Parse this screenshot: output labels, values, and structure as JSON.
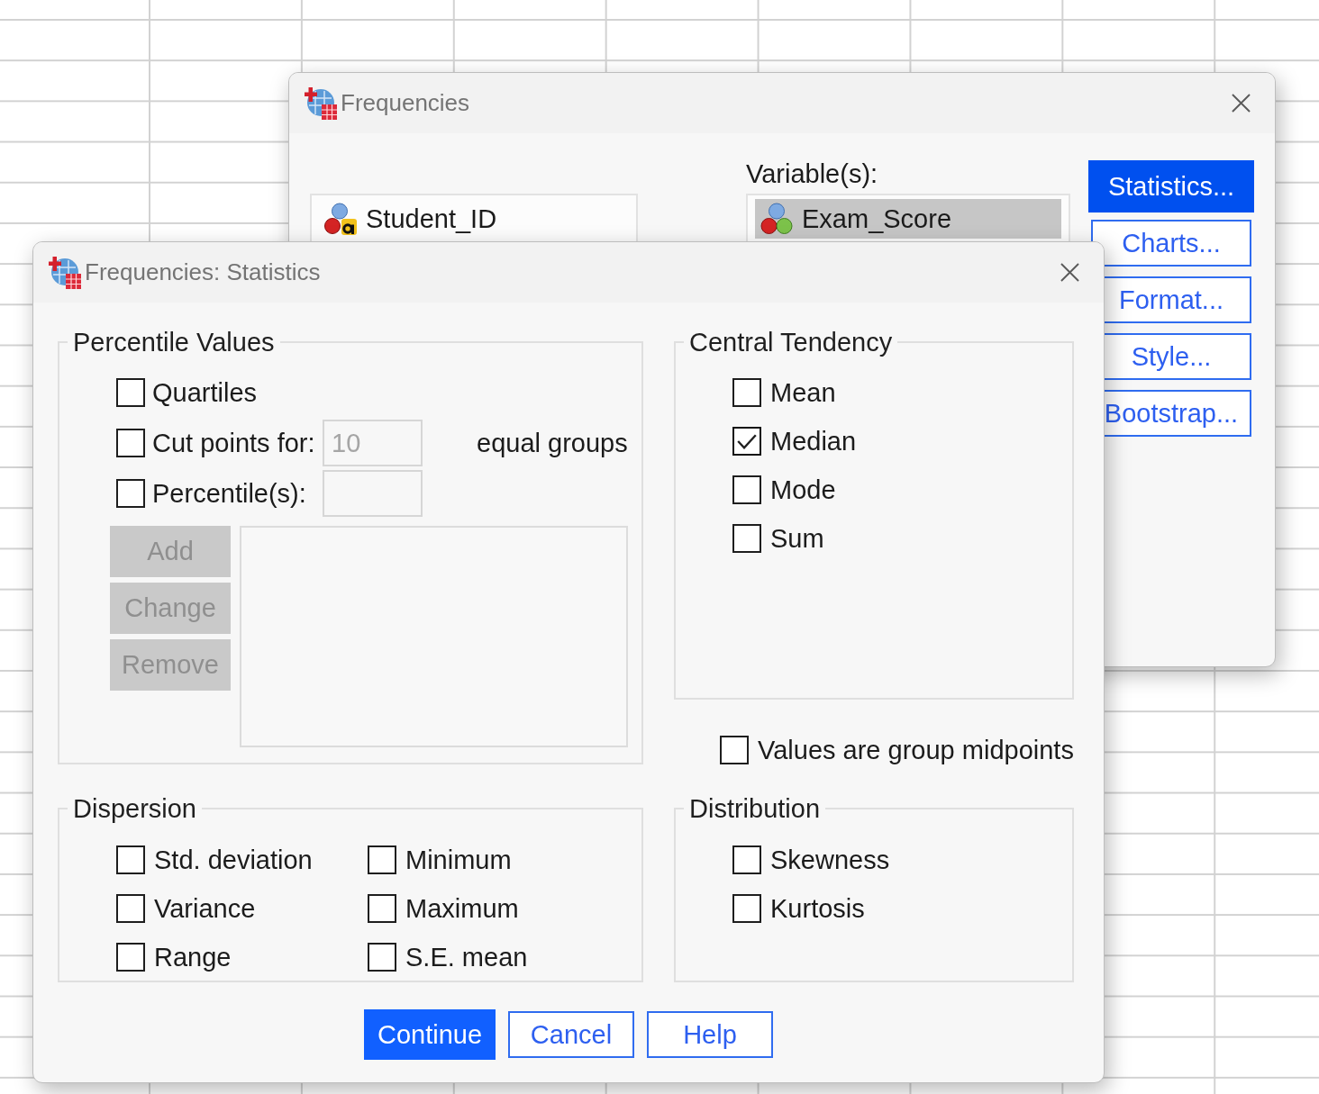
{
  "background_window": {
    "title": "Frequencies",
    "source_list": {
      "items": [
        {
          "name": "Student_ID",
          "kind": "string",
          "selected": false
        }
      ]
    },
    "target_list": {
      "label": "Variable(s):",
      "items": [
        {
          "name": "Exam_Score",
          "kind": "numeric",
          "selected": true
        }
      ]
    },
    "buttons": [
      {
        "label": "Statistics...",
        "pressed": true
      },
      {
        "label": "Charts...",
        "pressed": false
      },
      {
        "label": "Format...",
        "pressed": false
      },
      {
        "label": "Style...",
        "pressed": false
      },
      {
        "label": "Bootstrap...",
        "pressed": false
      }
    ]
  },
  "dialog": {
    "title": "Frequencies: Statistics",
    "percentile_values": {
      "title": "Percentile Values",
      "options": [
        {
          "kind": "plain",
          "label": "Quartiles",
          "checked": false
        },
        {
          "kind": "with_field",
          "label": "Cut points for:",
          "checked": false,
          "field": {
            "value": "10",
            "disabled": true
          },
          "suffix": "equal groups"
        },
        {
          "kind": "with_field",
          "label": "Percentile(s):",
          "checked": false,
          "field": {
            "disabled": true
          }
        }
      ],
      "buttons": [
        {
          "label": "Add",
          "disabled": true
        },
        {
          "label": "Change",
          "disabled": true
        },
        {
          "label": "Remove",
          "disabled": true
        }
      ]
    },
    "central_tendency": {
      "title": "Central Tendency",
      "options": [
        {
          "label": "Mean",
          "checked": false
        },
        {
          "label": "Median",
          "checked": true
        },
        {
          "label": "Mode",
          "checked": false
        },
        {
          "label": "Sum",
          "checked": false
        }
      ]
    },
    "group_midpoints": {
      "label": "Values are group midpoints",
      "checked": false
    },
    "dispersion": {
      "title": "Dispersion",
      "options": [
        {
          "label": "Std. deviation",
          "checked": false
        },
        {
          "label": "Variance",
          "checked": false
        },
        {
          "label": "Range",
          "checked": false
        },
        {
          "label": "Minimum",
          "checked": false
        },
        {
          "label": "Maximum",
          "checked": false
        },
        {
          "label": "S.E. mean",
          "checked": false
        }
      ]
    },
    "distribution": {
      "title": "Distribution",
      "options": [
        {
          "label": "Skewness",
          "checked": false
        },
        {
          "label": "Kurtosis",
          "checked": false
        }
      ]
    },
    "buttons": [
      {
        "label": "Continue",
        "default": true
      },
      {
        "label": "Cancel",
        "default": false
      },
      {
        "label": "Help",
        "default": false
      }
    ]
  }
}
